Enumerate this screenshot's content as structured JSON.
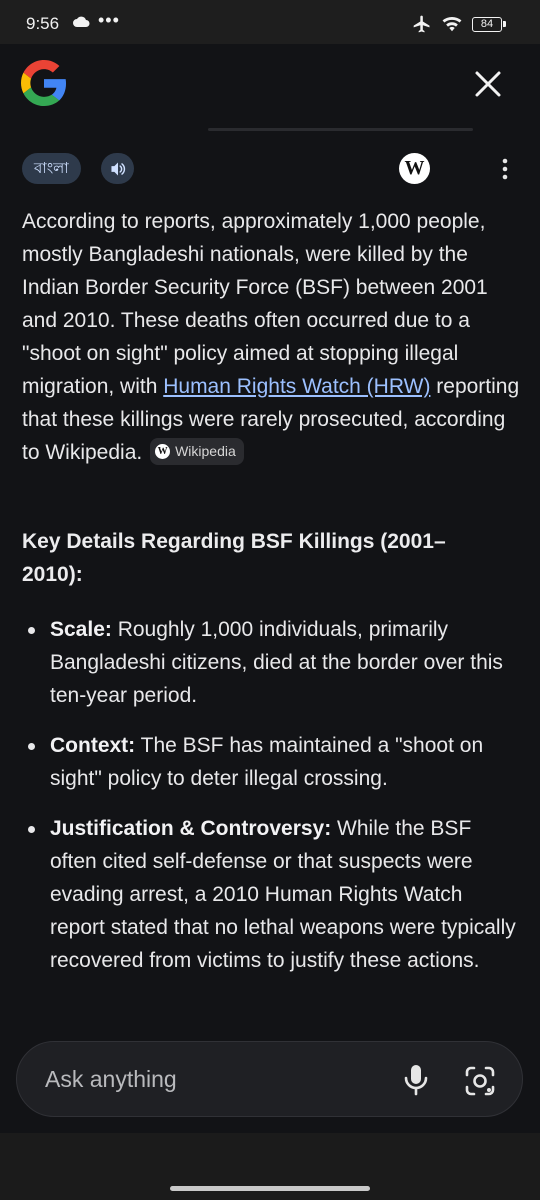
{
  "status": {
    "time": "9:56",
    "dots": "•••",
    "battery": "84"
  },
  "header": {
    "logo_icon": "google-g-icon",
    "close_icon": "close-icon"
  },
  "toolbar": {
    "language_chip": "বাংলা",
    "speaker_icon": "speaker-icon",
    "wiki_icon": "W",
    "more_icon": "more-vert-icon"
  },
  "answer": {
    "text_before_link": "According to reports, approximately 1,000 people, mostly Bangladeshi nationals, were killed by the Indian Border Security Force (BSF) between 2001 and 2010. These deaths often occurred due to a \"shoot on sight\" policy aimed at stopping illegal migration, with ",
    "link_text": "Human Rights Watch (HRW)",
    "text_after_link": " reporting that these killings were rarely prosecuted, according to Wikipedia.",
    "source_chip": "Wikipedia",
    "source_chip_icon": "W"
  },
  "section": {
    "heading": "Key Details Regarding BSF Killings (2001–2010):",
    "bullets": [
      {
        "label": "Scale:",
        "text": " Roughly 1,000 individuals, primarily Bangladeshi citizens, died at the border over this ten-year period."
      },
      {
        "label": "Context:",
        "text": " The BSF has maintained a \"shoot on sight\" policy to deter illegal crossing."
      },
      {
        "label": "Justification & Controversy:",
        "text": " While the BSF often cited self-defense or that suspects were evading arrest, a 2010 Human Rights Watch report stated that no lethal weapons were typically recovered from victims to justify these actions."
      }
    ]
  },
  "input": {
    "placeholder": "Ask anything",
    "mic_icon": "mic-icon",
    "lens_icon": "lens-icon"
  },
  "colors": {
    "background": "#121316",
    "link": "#9cc0ff",
    "chip": "#2e3a4b"
  }
}
